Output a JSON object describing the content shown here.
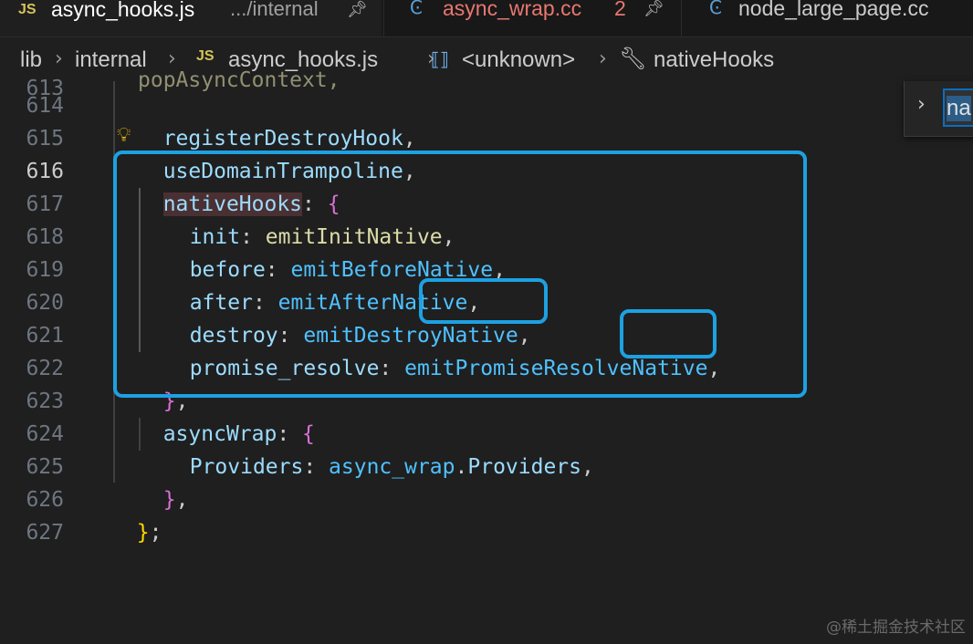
{
  "tabs": [
    {
      "icon": "JS",
      "name": "async_hooks.js",
      "path": ".../internal",
      "active": true
    },
    {
      "icon": "C++",
      "name": "async_wrap.cc",
      "badge": "2",
      "active": false
    },
    {
      "icon": "C++",
      "name": "node_large_page.cc",
      "active": false
    }
  ],
  "breadcrumb": {
    "items": [
      "lib",
      "internal",
      "async_hooks.js",
      "<unknown>",
      "nativeHooks"
    ],
    "file_icon": "JS"
  },
  "find_widget": {
    "value": "na"
  },
  "editor": {
    "current_line": "616",
    "lines": [
      {
        "num": "613",
        "text": "popAsyncContext,"
      },
      {
        "num": "614",
        "key": "registerDestroyHook",
        "after": ","
      },
      {
        "num": "615",
        "key": "useDomainTrampoline",
        "after": ","
      },
      {
        "num": "616",
        "key": "nativeHooks",
        "mid": ": ",
        "brace": "{"
      },
      {
        "num": "617",
        "key": "init",
        "mid": ": ",
        "val": "emitInitNative",
        "after": ","
      },
      {
        "num": "618",
        "key": "before",
        "mid": ": ",
        "val": "emitBeforeNative",
        "after": ","
      },
      {
        "num": "619",
        "key": "after",
        "mid": ": ",
        "val": "emitAfterNative",
        "after": ","
      },
      {
        "num": "620",
        "key": "destroy",
        "mid": ": ",
        "val": "emitDestroyNative",
        "after": ","
      },
      {
        "num": "621",
        "key": "promise_resolve",
        "mid": ": ",
        "val": "emitPromiseResolveNative",
        "after": ","
      },
      {
        "num": "622",
        "brace": "}",
        "after": ","
      },
      {
        "num": "623",
        "key": "asyncWrap",
        "mid": ": ",
        "brace": "{"
      },
      {
        "num": "624",
        "key": "Providers",
        "mid": ": ",
        "val": "async_wrap",
        "after2": ".",
        "val2": "Providers",
        "after": ","
      },
      {
        "num": "625",
        "brace": "}",
        "after": ","
      },
      {
        "num": "626",
        "brace": "}",
        "after": ";"
      },
      {
        "num": "627"
      }
    ]
  },
  "watermark": "@稀土掘金技术社区",
  "colors": {
    "highlight_box": "#1da1e2",
    "background": "#1f1f1f"
  }
}
